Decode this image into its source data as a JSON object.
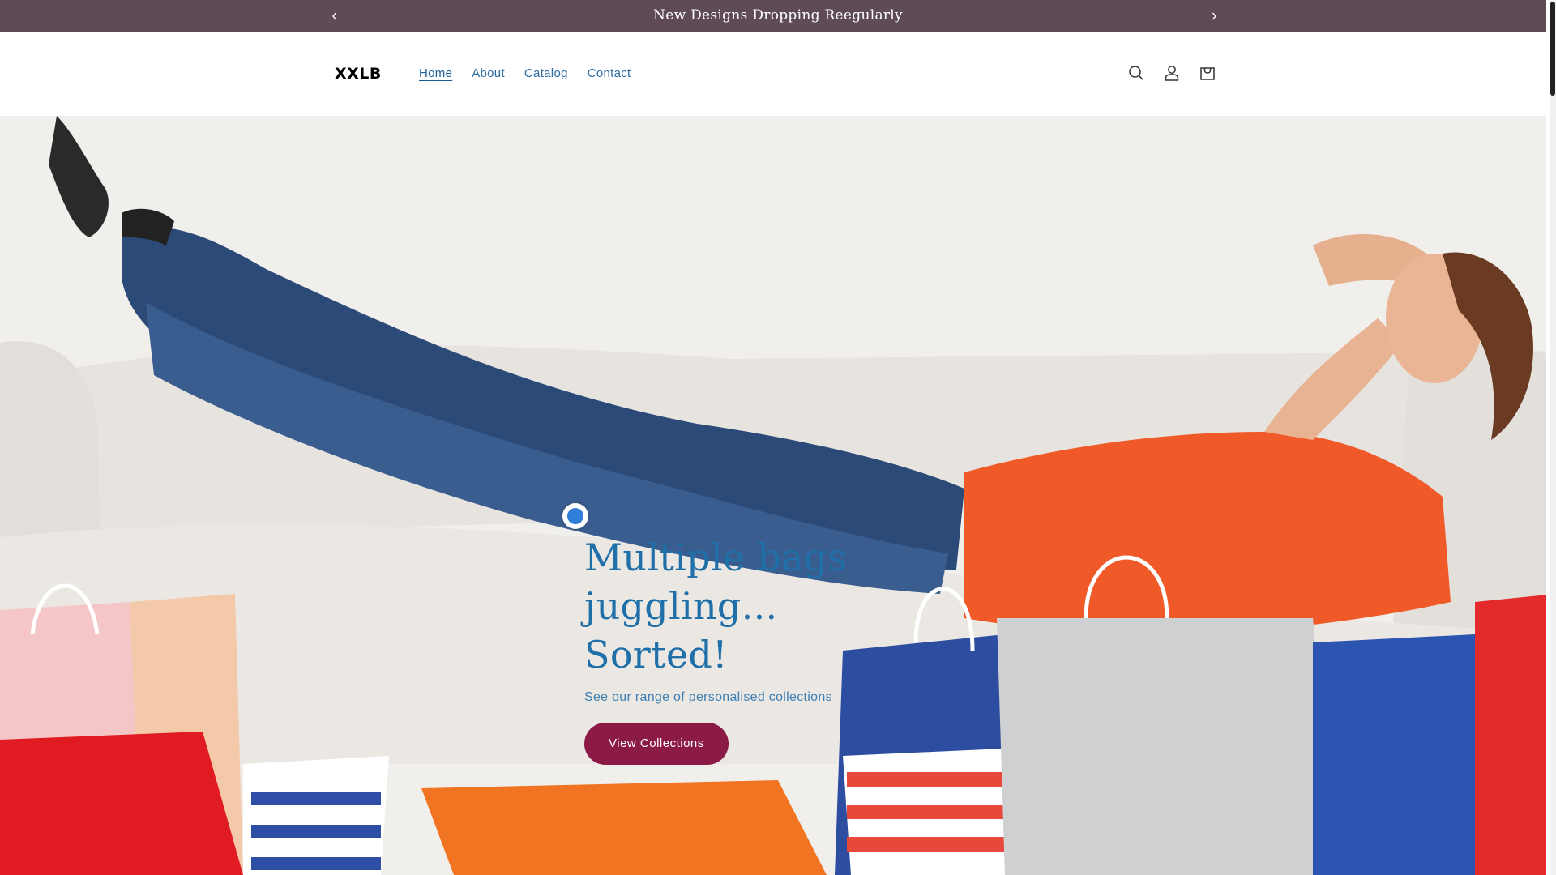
{
  "announcement": {
    "message": "New Designs Dropping Reegularly",
    "prev_icon": "chevron-left-icon",
    "next_icon": "chevron-right-icon"
  },
  "header": {
    "logo": "XXLB",
    "nav": [
      {
        "label": "Home",
        "active": true
      },
      {
        "label": "About",
        "active": false
      },
      {
        "label": "Catalog",
        "active": false
      },
      {
        "label": "Contact",
        "active": false
      }
    ],
    "icons": [
      "search-icon",
      "account-icon",
      "cart-icon"
    ]
  },
  "hero": {
    "title_line1": "Multiple bags",
    "title_line2": "juggling... Sorted!",
    "subtitle": "See our range of personalised collections",
    "button_label": "View Collections"
  },
  "colors": {
    "announcement_bg": "#5f4b57",
    "accent_button": "#8c1a46",
    "heading": "#1f6fa8",
    "nav_link": "#2d6aa0"
  }
}
